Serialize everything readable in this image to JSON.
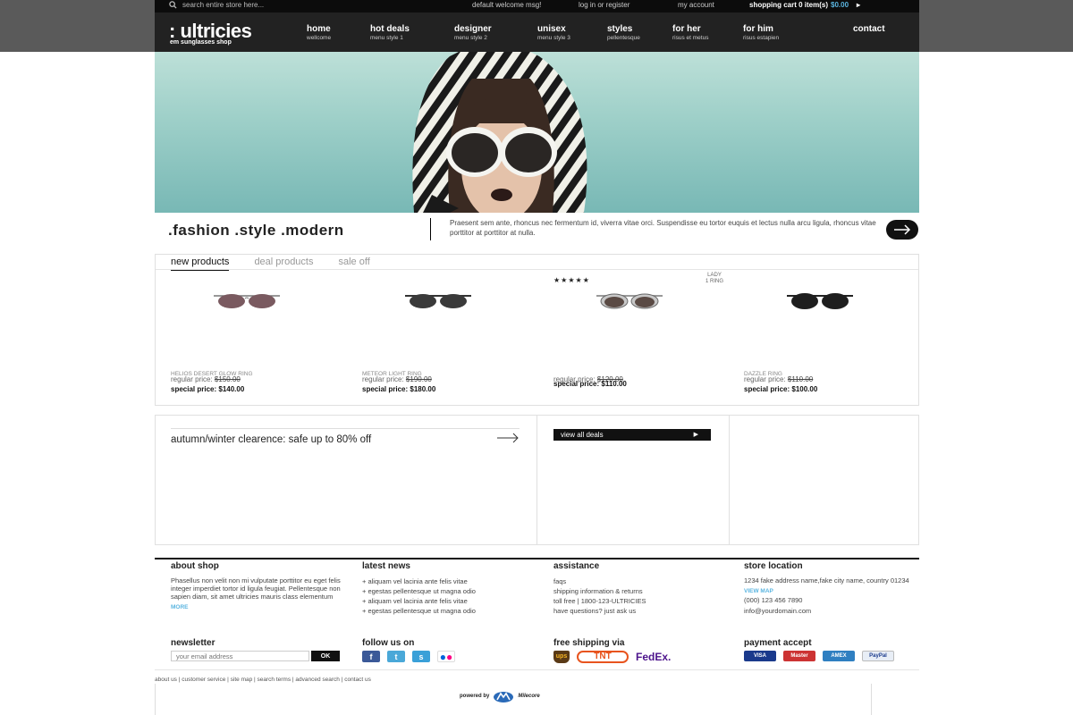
{
  "topbar": {
    "search_placeholder": "search entire store here...",
    "welcome": "default welcome msg!",
    "login": "log in or register",
    "account": "my account",
    "cart_label": "shopping cart 0 item(s)",
    "cart_amount": "$0.00"
  },
  "brand": {
    "logo": ": ultricies",
    "tagline": "em sunglasses shop"
  },
  "nav": [
    {
      "title": "home",
      "sub": "wellcome"
    },
    {
      "title": "hot deals",
      "sub": "menu style 1"
    },
    {
      "title": "designer",
      "sub": "menu style 2"
    },
    {
      "title": "unisex",
      "sub": "menu style 3"
    },
    {
      "title": "styles",
      "sub": "pellentesque"
    },
    {
      "title": "for her",
      "sub": "risus et metus"
    },
    {
      "title": "for him",
      "sub": "risus estapien"
    },
    {
      "title": "contact",
      "sub": ""
    }
  ],
  "strip": {
    "headline": ".fashion  .style  .modern",
    "text": "Praesent sem ante, rhoncus nec fermentum id, viverra vitae orci. Suspendisse eu tortor euquis et lectus nulla arcu ligula, rhoncus vitae porttitor at porttitor at nulla."
  },
  "tabs": [
    "new products",
    "deal products",
    "sale off"
  ],
  "products": [
    {
      "name": "HELIOS DESERT GLOW RING",
      "regular_label": "regular price:",
      "regular": "$150.00",
      "special_label": "special price:",
      "special": "$140.00"
    },
    {
      "name": "METEOR LIGHT RING",
      "regular_label": "regular price:",
      "regular": "$190.00",
      "special_label": "special price:",
      "special": "$180.00"
    },
    {
      "name": "",
      "regular_label": "regular price:",
      "regular": "$120.00",
      "special_label": "special price:",
      "special": "$110.00",
      "stars": "★★★★★",
      "badge_1": "LADY",
      "badge_2": "1 RING"
    },
    {
      "name": "DAZZLE RING",
      "regular_label": "regular price:",
      "regular": "$110.00",
      "special_label": "special price:",
      "special": "$100.00"
    }
  ],
  "promo": {
    "clearance": "autumn/winter clearence: safe up to 80% off",
    "deals_btn": "view all deals"
  },
  "footer": {
    "about": {
      "title": "about shop",
      "text": "Phasellus non velit non mi vulputate porttitor eu eget felis integer imperdiet tortor id ligula feugiat. Pellentesque non sapien diam, sit amet ultricies mauris class elementum",
      "more": "MORE"
    },
    "news": {
      "title": "latest news",
      "items": [
        "aliquam vel lacinia ante felis vitae",
        "egestas pellentesque ut magna odio",
        "aliquam vel lacinia ante felis vitae",
        "egestas pellentesque ut magna odio"
      ]
    },
    "assistance": {
      "title": "assistance",
      "items": [
        "faqs",
        "shipping information & returns",
        "toll free | 1800-123-ULTRICIES",
        "have questions? just ask us"
      ]
    },
    "store": {
      "title": "store location",
      "address": "1234 fake address name,fake city name, country 01234",
      "map": "VIEW MAP",
      "phone": "(000) 123 456 7890",
      "email": "info@yourdomain.com"
    },
    "newsletter": {
      "title": "newsletter",
      "placeholder": "your email address",
      "button": "OK"
    },
    "follow": {
      "title": "follow us on"
    },
    "shipping": {
      "title": "free shipping via",
      "ups": "ups",
      "tnt": "TNT",
      "fedex": "FedEx."
    },
    "payment": {
      "title": "payment accept",
      "visa": "VISA",
      "mc": "Master",
      "amex": "AMEX",
      "paypal": "PayPal"
    }
  },
  "bottom_links": "about us  |  customer service  |  site map  |  search terms  |  advanced search  |  contact us",
  "powered": {
    "label": "powered by",
    "brand": "Milecore"
  },
  "colors": {
    "accent": "#5bb5e0",
    "dark": "#111111"
  }
}
